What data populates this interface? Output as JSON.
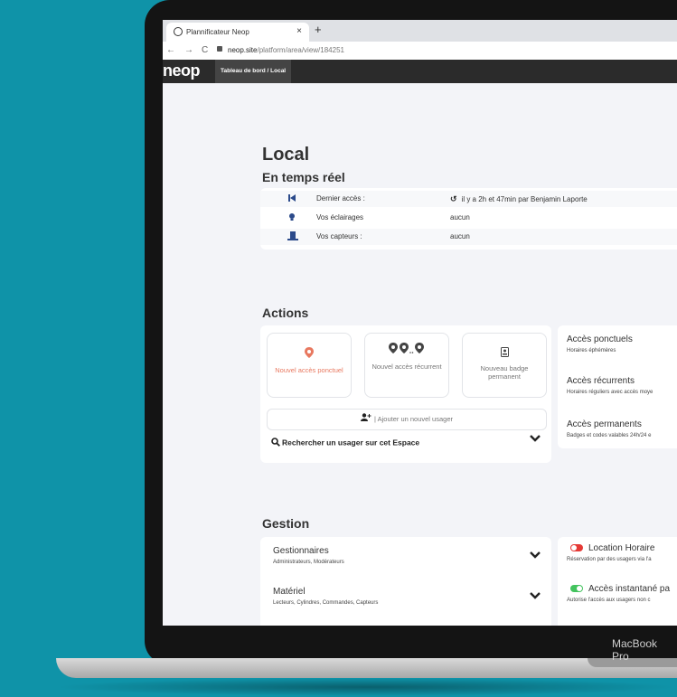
{
  "device": {
    "brand": "MacBook Pro"
  },
  "browser": {
    "tab_title": "Plannificateur Neop",
    "tab_close": "×",
    "new_tab": "+",
    "url_domain": "neop.site",
    "url_path": "/platform/area/view/184251",
    "nav": {
      "back": "←",
      "forward": "→",
      "reload": "C"
    }
  },
  "app": {
    "logo": "neop",
    "breadcrumb": "Tableau de bord / Local"
  },
  "page": {
    "title": "Local"
  },
  "realtime": {
    "title": "En temps réel",
    "rows": [
      {
        "icon": "skip-back-icon",
        "label": "Dernier accès :",
        "value": "il y a 2h et 47min par Benjamin Laporte"
      },
      {
        "icon": "lightbulb-icon",
        "label": "Vos éclairages",
        "value": "aucun"
      },
      {
        "icon": "door-sensor-icon",
        "label": "Vos capteurs :",
        "value": "aucun"
      }
    ]
  },
  "actions": {
    "title": "Actions",
    "tiles": [
      {
        "label": "Nouvel accès ponctuel"
      },
      {
        "label": "Nouvel accès récurrent"
      },
      {
        "label": "Nouveau badge permanent"
      }
    ],
    "add_user": "| Ajouter un nouvel usager",
    "search_user": "Rechercher un usager sur cet Espace"
  },
  "access_types": [
    {
      "title": "Accès ponctuels",
      "subtitle": "Horaires éphémères"
    },
    {
      "title": "Accès récurrents",
      "subtitle": "Horaires réguliers avec accès moye"
    },
    {
      "title": "Accès permanents",
      "subtitle": "Badges et codes valables 24h/24 e"
    }
  ],
  "gestion": {
    "title": "Gestion",
    "items": [
      {
        "title": "Gestionnaires",
        "subtitle": "Administrateurs, Modérateurs"
      },
      {
        "title": "Matériel",
        "subtitle": "Lecteurs, Cylindres, Commandes, Capteurs"
      }
    ]
  },
  "options": [
    {
      "title": "Location Horaire",
      "subtitle": "Réservation par des usagers via l'a",
      "enabled": false,
      "color": "#e53935"
    },
    {
      "title": "Accès instantané pa",
      "subtitle": "Autorise l'accès aux usagers non c",
      "enabled": true,
      "color": "#43c35e"
    }
  ],
  "colors": {
    "accent": "#e8785f",
    "app_bar": "#2b2b2b",
    "background": "#0f93a8"
  }
}
